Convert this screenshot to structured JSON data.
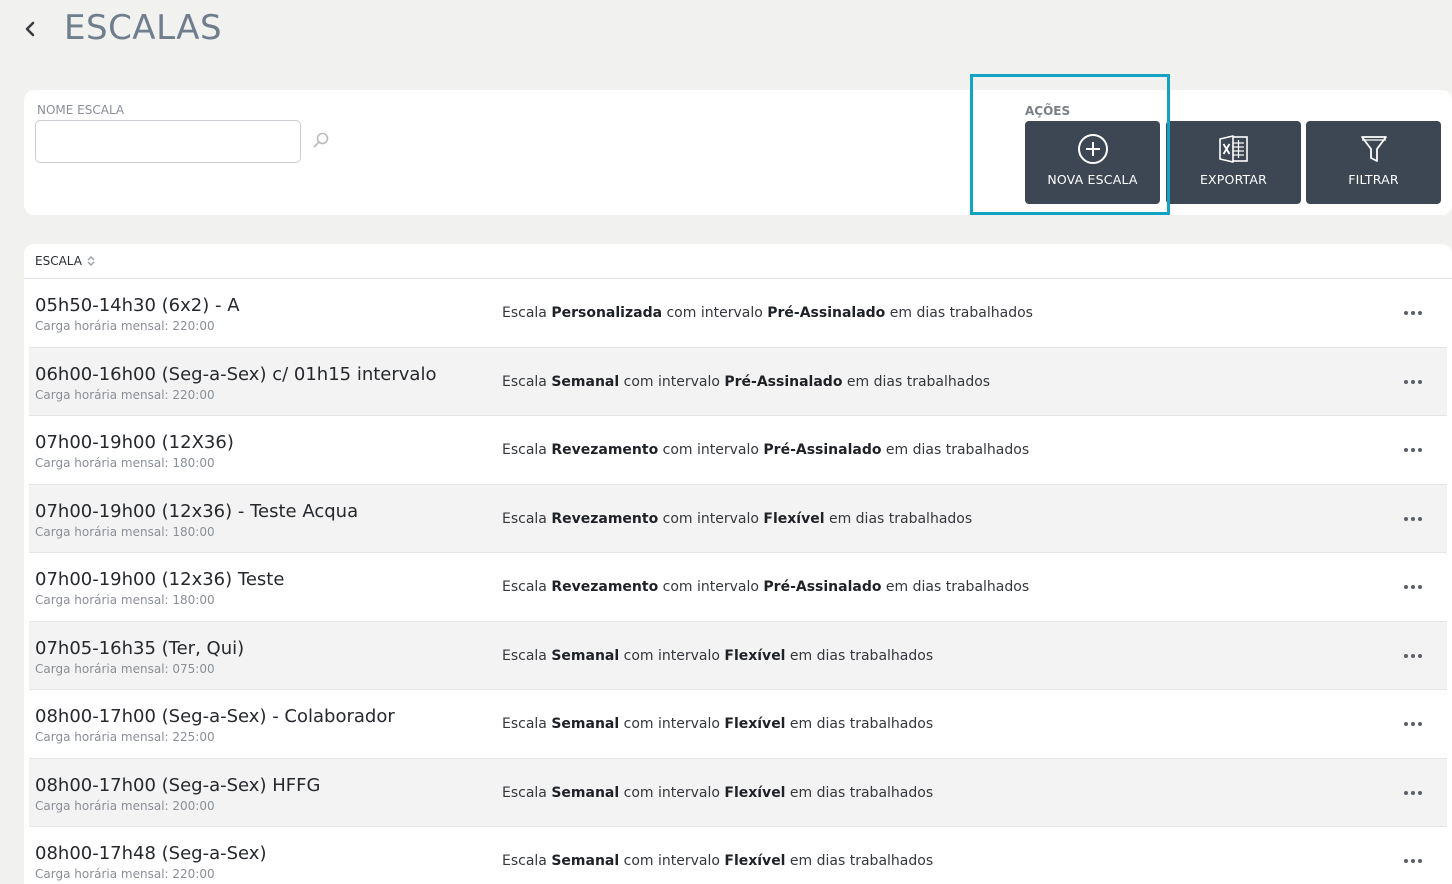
{
  "header": {
    "title": "ESCALAS"
  },
  "filters": {
    "name_label": "NOME ESCALA",
    "name_value": "",
    "name_placeholder": ""
  },
  "actions": {
    "label": "AÇÕES",
    "new_label": "NOVA ESCALA",
    "export_label": "EXPORTAR",
    "filter_label": "FILTRAR"
  },
  "colors": {
    "action_button": "#3c4753",
    "highlight": "#12a3c4",
    "title": "#6f7d8c"
  },
  "table": {
    "column_header": "ESCALA",
    "rows": [
      {
        "name": "05h50-14h30 (6x2) - A",
        "sub": "Carga horária mensal: 220:00",
        "desc_prefix": "Escala ",
        "type": "Personalizada",
        "desc_mid": " com intervalo ",
        "interval": "Pré-Assinalado",
        "desc_suffix": " em dias trabalhados"
      },
      {
        "name": "06h00-16h00 (Seg-a-Sex) c/ 01h15 intervalo",
        "sub": "Carga horária mensal: 220:00",
        "desc_prefix": "Escala ",
        "type": "Semanal",
        "desc_mid": " com intervalo ",
        "interval": "Pré-Assinalado",
        "desc_suffix": " em dias trabalhados"
      },
      {
        "name": "07h00-19h00 (12X36)",
        "sub": "Carga horária mensal: 180:00",
        "desc_prefix": "Escala ",
        "type": "Revezamento",
        "desc_mid": " com intervalo ",
        "interval": "Pré-Assinalado",
        "desc_suffix": " em dias trabalhados"
      },
      {
        "name": "07h00-19h00 (12x36) - Teste Acqua",
        "sub": "Carga horária mensal: 180:00",
        "desc_prefix": "Escala ",
        "type": "Revezamento",
        "desc_mid": " com intervalo ",
        "interval": "Flexível",
        "desc_suffix": " em dias trabalhados"
      },
      {
        "name": "07h00-19h00 (12x36) Teste",
        "sub": "Carga horária mensal: 180:00",
        "desc_prefix": "Escala ",
        "type": "Revezamento",
        "desc_mid": " com intervalo ",
        "interval": "Pré-Assinalado",
        "desc_suffix": " em dias trabalhados"
      },
      {
        "name": "07h05-16h35 (Ter, Qui)",
        "sub": "Carga horária mensal: 075:00",
        "desc_prefix": "Escala ",
        "type": "Semanal",
        "desc_mid": " com intervalo ",
        "interval": "Flexível",
        "desc_suffix": " em dias trabalhados"
      },
      {
        "name": "08h00-17h00 (Seg-a-Sex) - Colaborador",
        "sub": "Carga horária mensal: 225:00",
        "desc_prefix": "Escala ",
        "type": "Semanal",
        "desc_mid": " com intervalo ",
        "interval": "Flexível",
        "desc_suffix": " em dias trabalhados"
      },
      {
        "name": "08h00-17h00 (Seg-a-Sex) HFFG",
        "sub": "Carga horária mensal: 200:00",
        "desc_prefix": "Escala ",
        "type": "Semanal",
        "desc_mid": " com intervalo ",
        "interval": "Flexível",
        "desc_suffix": " em dias trabalhados"
      },
      {
        "name": "08h00-17h48 (Seg-a-Sex)",
        "sub": "Carga horária mensal: 220:00",
        "desc_prefix": "Escala ",
        "type": "Semanal",
        "desc_mid": " com intervalo ",
        "interval": "Flexível",
        "desc_suffix": " em dias trabalhados"
      }
    ]
  }
}
